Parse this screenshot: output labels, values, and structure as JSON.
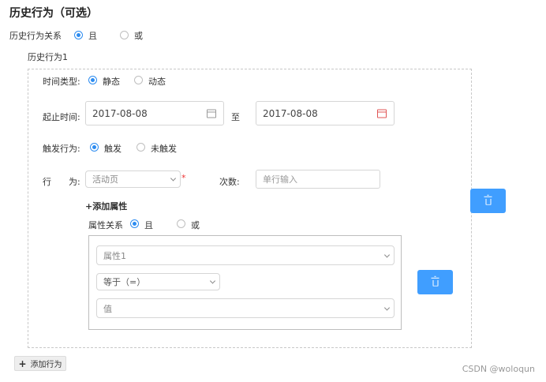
{
  "page_title": "历史行为（可选）",
  "relation": {
    "label": "历史行为关系",
    "options": [
      "且",
      "或"
    ],
    "selected": "且"
  },
  "behavior": {
    "title": "历史行为1",
    "time_type": {
      "label": "时间类型:",
      "options": [
        "静态",
        "动态"
      ],
      "selected": "静态"
    },
    "time_range": {
      "label": "起止时间:",
      "start": "2017-08-08",
      "separator": "至",
      "end": "2017-08-08"
    },
    "trigger": {
      "label": "触发行为:",
      "options": [
        "触发",
        "未触发"
      ],
      "selected": "触发"
    },
    "action": {
      "label": "行　　为:",
      "placeholder": "活动页",
      "required_mark": "*"
    },
    "count": {
      "label": "次数:",
      "placeholder": "单行输入"
    },
    "add_attr_label": "+添加属性",
    "attr_relation": {
      "label": "属性关系",
      "options": [
        "且",
        "或"
      ],
      "selected": "且"
    },
    "attribute": {
      "field": "属性1",
      "operator": "等于（=）",
      "value": "值"
    }
  },
  "add_behavior_label": "添加行为",
  "add_behavior_plus": "+",
  "watermark": "CSDN @woloqun",
  "colors": {
    "accent": "#409eff",
    "radio": "#2d8cf0",
    "required": "#e33333"
  }
}
